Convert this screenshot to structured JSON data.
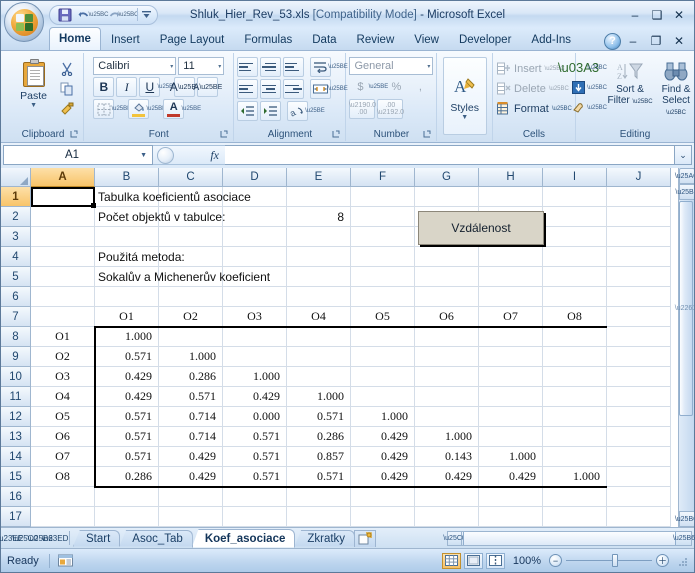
{
  "window": {
    "title_file": "Shluk_Hier_Rev_53.xls",
    "title_mode": "[Compatibility Mode]",
    "title_app": "- Microsoft Excel",
    "minimize": "–",
    "maximize": "❑",
    "close": "✕",
    "doc_help": "?",
    "doc_minimize": "–",
    "doc_restore": "❐",
    "doc_close": "✕"
  },
  "quick_access": {
    "save": "💾",
    "undo": "↶",
    "redo": "↷",
    "customize": "≡"
  },
  "ribbon_tabs": [
    {
      "label": "Home",
      "active": true
    },
    {
      "label": "Insert",
      "active": false
    },
    {
      "label": "Page Layout",
      "active": false
    },
    {
      "label": "Formulas",
      "active": false
    },
    {
      "label": "Data",
      "active": false
    },
    {
      "label": "Review",
      "active": false
    },
    {
      "label": "View",
      "active": false
    },
    {
      "label": "Developer",
      "active": false
    },
    {
      "label": "Add-Ins",
      "active": false
    }
  ],
  "ribbon": {
    "clipboard": {
      "label": "Clipboard",
      "paste": "Paste",
      "paste_arrow": "▼",
      "cut": "✂",
      "copy": "❐",
      "format_painter": "🖌",
      "launcher": "⤵"
    },
    "font": {
      "label": "Font",
      "font_name": "Calibri",
      "font_size": "11",
      "bold": "B",
      "italic": "I",
      "underline": "U",
      "grow_font": "A▴",
      "shrink_font": "A▾",
      "borders": "▦",
      "fill_color": "🎨",
      "font_color": "A",
      "caret": "▾",
      "launcher": "⤵"
    },
    "alignment": {
      "label": "Alignment",
      "align_top": "top",
      "align_middle": "middle",
      "align_bottom": "bottom",
      "align_left": "left",
      "align_center": "center",
      "align_right": "right",
      "decrease_indent": "⇤",
      "increase_indent": "⇥",
      "orientation": "⤵",
      "wrap_text": "↵",
      "merge_center": "⊞",
      "caret": "▾",
      "launcher": "⤵"
    },
    "number": {
      "label": "Number",
      "format": "General",
      "currency": "$",
      "percent": "%",
      "comma": ",",
      "increase_decimal": ".00",
      "decrease_decimal": ".0",
      "caret": "▾",
      "launcher": "⤵"
    },
    "styles": {
      "label": "Styles",
      "button": "Styles",
      "arrow": "▼"
    },
    "cells": {
      "label": "Cells",
      "insert": "Insert",
      "delete": "Delete",
      "format": "Format",
      "caret": "▾"
    },
    "editing": {
      "label": "Editing",
      "autosum": "Σ",
      "fill": "⬇",
      "clear": "⊘",
      "sort_filter": "Sort &\nFilter",
      "sort_filter_l1": "Sort &",
      "sort_filter_l2": "Filter",
      "find_select_l1": "Find &",
      "find_select_l2": "Select",
      "caret": "▾"
    }
  },
  "formula_bar": {
    "name_box": "A1",
    "name_caret": "▼",
    "fx_label": "fx",
    "formula_value": "",
    "expand": "⌄"
  },
  "grid": {
    "columns": [
      "A",
      "B",
      "C",
      "D",
      "E",
      "F",
      "G",
      "H",
      "I",
      "J"
    ],
    "selected_column": "A",
    "rows": [
      "1",
      "2",
      "3",
      "4",
      "5",
      "6",
      "7",
      "8",
      "9",
      "10",
      "11",
      "12",
      "13",
      "14",
      "15",
      "16",
      "17"
    ],
    "selected_row": "1",
    "selected_cell": "A1",
    "texts": {
      "title": "Tabulka koeficientů asociace",
      "count_label": "Počet objektů v tabulce:",
      "count_value": "8",
      "method_label": "Použitá metoda:",
      "method_value": "Sokalův a Michenerův koeficient"
    },
    "distance_button": "Vzdálenost"
  },
  "chart_data": {
    "type": "table",
    "title": "Tabulka koeficientů asociace",
    "subtitle": "Sokalův a Michenerův koeficient",
    "object_count": 8,
    "row_labels": [
      "O1",
      "O2",
      "O3",
      "O4",
      "O5",
      "O6",
      "O7",
      "O8"
    ],
    "col_headers": [
      "O1",
      "O2",
      "O3",
      "O4",
      "O5",
      "O6",
      "O7",
      "O8"
    ],
    "matrix": [
      [
        "1.000",
        "",
        "",
        "",
        "",
        "",
        "",
        ""
      ],
      [
        "0.571",
        "1.000",
        "",
        "",
        "",
        "",
        "",
        ""
      ],
      [
        "0.429",
        "0.286",
        "1.000",
        "",
        "",
        "",
        "",
        ""
      ],
      [
        "0.429",
        "0.571",
        "0.429",
        "1.000",
        "",
        "",
        "",
        ""
      ],
      [
        "0.571",
        "0.714",
        "0.000",
        "0.571",
        "1.000",
        "",
        "",
        ""
      ],
      [
        "0.571",
        "0.714",
        "0.571",
        "0.286",
        "0.429",
        "1.000",
        "",
        ""
      ],
      [
        "0.571",
        "0.429",
        "0.571",
        "0.857",
        "0.429",
        "0.143",
        "1.000",
        ""
      ],
      [
        "0.286",
        "0.429",
        "0.571",
        "0.571",
        "0.429",
        "0.429",
        "0.429",
        "1.000"
      ]
    ]
  },
  "sheet_tabs": {
    "first": "⏮",
    "prev": "◀",
    "next": "▶",
    "last": "⏭",
    "items": [
      {
        "label": "Start",
        "active": false
      },
      {
        "label": "Asoc_Tab",
        "active": false
      },
      {
        "label": "Koef_asociace",
        "active": true
      },
      {
        "label": "Zkratky",
        "active": false
      }
    ],
    "new_sheet": "➕"
  },
  "status_bar": {
    "mode": "Ready",
    "normal_view": "▦",
    "layout_view": "▤",
    "break_view": "▥",
    "zoom": "100%",
    "zoom_out": "−",
    "zoom_in": "＋"
  }
}
